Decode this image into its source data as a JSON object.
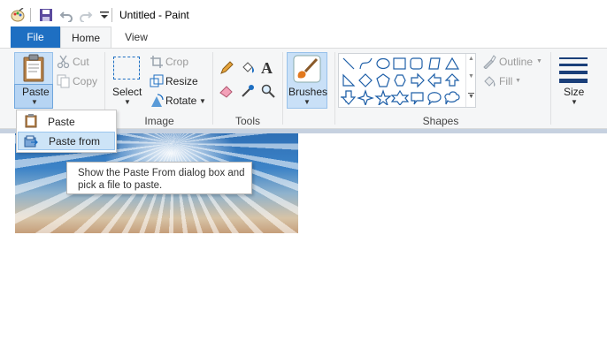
{
  "window": {
    "title": "Untitled - Paint"
  },
  "tabs": [
    {
      "label": "File"
    },
    {
      "label": "Home"
    },
    {
      "label": "View"
    }
  ],
  "clipboard": {
    "paste_label": "Paste",
    "cut_label": "Cut",
    "copy_label": "Copy"
  },
  "image": {
    "select_label": "Select",
    "crop_label": "Crop",
    "resize_label": "Resize",
    "rotate_label": "Rotate",
    "group_label": "Image"
  },
  "tools": {
    "group_label": "Tools"
  },
  "brushes": {
    "label": "Brushes"
  },
  "shapes": {
    "outline_label": "Outline",
    "fill_label": "Fill",
    "group_label": "Shapes",
    "items": [
      "line",
      "curve",
      "oval",
      "rectangle",
      "rounded-rectangle",
      "polygon",
      "triangle",
      "right-triangle",
      "diamond",
      "pentagon",
      "hexagon",
      "right-arrow",
      "left-arrow",
      "up-arrow",
      "down-arrow",
      "four-point-star",
      "five-point-star",
      "six-point-star",
      "rounded-callout",
      "oval-callout",
      "cloud-callout"
    ]
  },
  "size": {
    "label": "Size"
  },
  "paste_menu": {
    "items": [
      {
        "label": "Paste",
        "icon": "clipboard-icon"
      },
      {
        "label": "Paste from",
        "icon": "paste-from-icon"
      }
    ]
  },
  "tooltip": {
    "text": "Show the Paste From dialog box and pick a file to paste."
  },
  "colors": {
    "accent": "#1e6fc2",
    "ribbon_bg": "#f5f6f7",
    "highlight": "#c9e0f7"
  }
}
